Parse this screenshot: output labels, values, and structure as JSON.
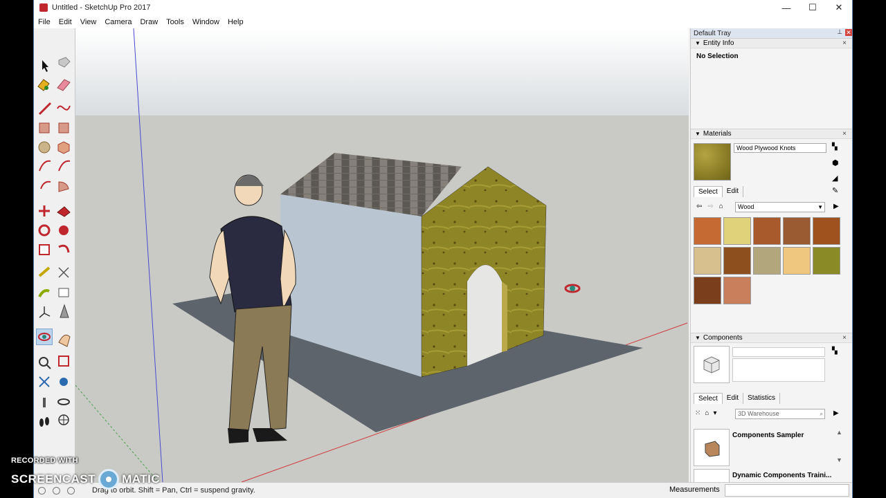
{
  "window": {
    "title": "Untitled - SketchUp Pro 2017",
    "controls": {
      "minimize": "—",
      "maximize": "☐",
      "close": "✕"
    }
  },
  "menu": [
    "File",
    "Edit",
    "View",
    "Camera",
    "Draw",
    "Tools",
    "Window",
    "Help"
  ],
  "toolbar_tools": [
    "select",
    "make-component",
    "paint-bucket",
    "eraser",
    "line",
    "freehand",
    "rectangle",
    "rotated-rectangle",
    "circle",
    "polygon",
    "arc",
    "arc-3point",
    "pie",
    "arc-2point",
    "move",
    "push-pull",
    "rotate",
    "follow-me",
    "scale",
    "offset",
    "tape-measure",
    "dimensions",
    "protractor",
    "text",
    "axes",
    "3d-text",
    "orbit",
    "pan",
    "zoom",
    "zoom-window",
    "zoom-extents",
    "previous-view",
    "position-camera",
    "look-around",
    "walk",
    "section-plane"
  ],
  "tray": {
    "title": "Default Tray",
    "entity_info": {
      "header": "Entity Info",
      "selection": "No Selection"
    },
    "materials": {
      "header": "Materials",
      "current_material": "Wood Plywood Knots",
      "tabs": [
        "Select",
        "Edit"
      ],
      "library": "Wood",
      "swatch_colors": [
        "#c46a32",
        "#e0d27a",
        "#a85a2c",
        "#9a5a32",
        "#a0521e",
        "#d8c08e",
        "#8e4f1f",
        "#b2a77c",
        "#f0c77e",
        "#8a8a26",
        "#7a3e1c",
        "#c97f5c"
      ]
    },
    "components": {
      "header": "Components",
      "tabs": [
        "Select",
        "Edit",
        "Statistics"
      ],
      "search_placeholder": "3D Warehouse",
      "list": [
        "Components Sampler",
        "Dynamic Components Traini..."
      ]
    }
  },
  "status": {
    "hint": "Drag to orbit. Shift = Pan, Ctrl = suspend gravity.",
    "measurements_label": "Measurements"
  },
  "watermark": {
    "line1": "RECORDED WITH",
    "word_left": "SCREENCAST",
    "word_right": "MATIC"
  },
  "colors": {
    "sky": "#dfe3e6",
    "ground": "#c9c9c6",
    "plywood": "#8e8527",
    "wall_side": "#b9c6d1",
    "roof": "#6e6a66",
    "floor_plane": "#5e646b",
    "shirt": "#2a2a40",
    "pants": "#8a7a55"
  }
}
